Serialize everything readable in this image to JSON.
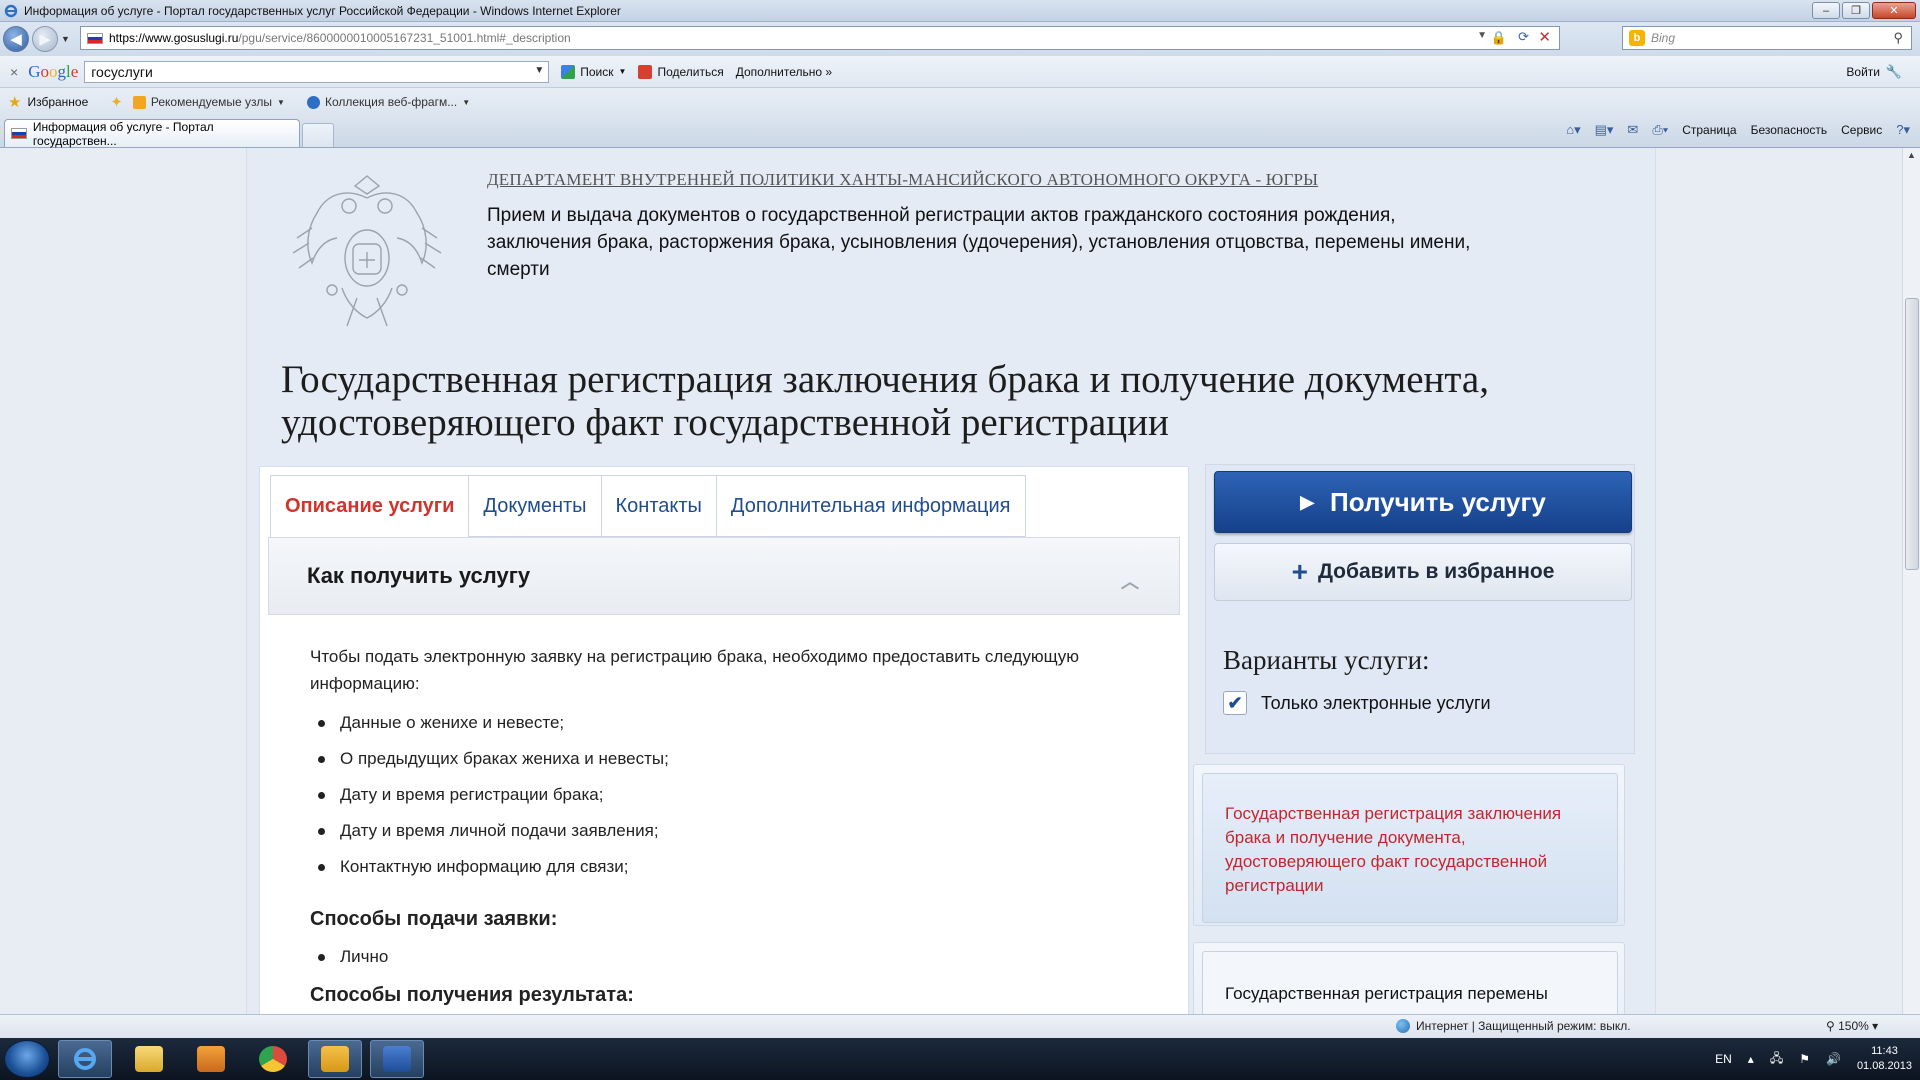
{
  "window": {
    "title": "Информация об услуге - Портал государственных услуг Российской Федерации - Windows Internet Explorer"
  },
  "address": {
    "host": "https://www.gosuslugi.ru",
    "rest": "/pgu/service/8600000010005167231_51001.html#_description",
    "search_placeholder": "Bing"
  },
  "google_bar": {
    "logo": "Google",
    "query": "госуслуги",
    "search_label": "Поиск",
    "share_label": "Поделиться",
    "more_label": "Дополнительно »",
    "login_label": "Войти"
  },
  "favorites": {
    "label": "Избранное",
    "items": [
      "Рекомендуемые узлы",
      "Коллекция веб-фрагм..."
    ]
  },
  "tab": {
    "title": "Информация об услуге - Портал государствен..."
  },
  "command_bar": {
    "page": "Страница",
    "safety": "Безопасность",
    "tools": "Сервис"
  },
  "page": {
    "department": "ДЕПАРТАМЕНТ ВНУТРЕННЕЙ ПОЛИТИКИ ХАНТЫ-МАНСИЙСКОГО АВТОНОМНОГО ОКРУГА - ЮГРЫ",
    "service_description": "Прием и выдача документов о государственной регистрации актов гражданского состояния рождения, заключения брака, расторжения брака, усыновления (удочерения), установления отцовства, перемены имени, смерти",
    "title": "Государственная регистрация заключения брака и получение документа, удостоверяющего факт государственной регистрации",
    "tabs": [
      "Описание услуги",
      "Документы",
      "Контакты",
      "Дополнительная информация"
    ],
    "accordion_title": "Как получить услугу",
    "intro": "Чтобы подать электронную заявку на регистрацию брака, необходимо предоставить следующую информацию:",
    "items": [
      "Данные о женихе и невесте;",
      "О предыдущих браках жениха и невесты;",
      "Дату и время регистрации брака;",
      "Дату и время личной подачи заявления;",
      "Контактную информацию для связи;"
    ],
    "submit_methods_title": "Способы подачи заявки:",
    "submit_methods": [
      "Лично"
    ],
    "result_methods_title": "Способы получения результата:"
  },
  "sidebar": {
    "get_service": "Получить услугу",
    "add_favorite": "Добавить в избранное",
    "variants_title": "Варианты услуги:",
    "electronic_only": "Только электронные услуги",
    "electronic_only_checked": true,
    "option_1": "Государственная регистрация заключения брака и получение документа, удостоверяющего факт государственной регистрации",
    "option_2": "Государственная регистрация перемены имени и получение документа,"
  },
  "status": {
    "zone": "Интернет | Защищенный режим: выкл.",
    "zoom": "150%"
  },
  "taskbar": {
    "lang": "EN",
    "time": "11:43",
    "date": "01.08.2013"
  }
}
